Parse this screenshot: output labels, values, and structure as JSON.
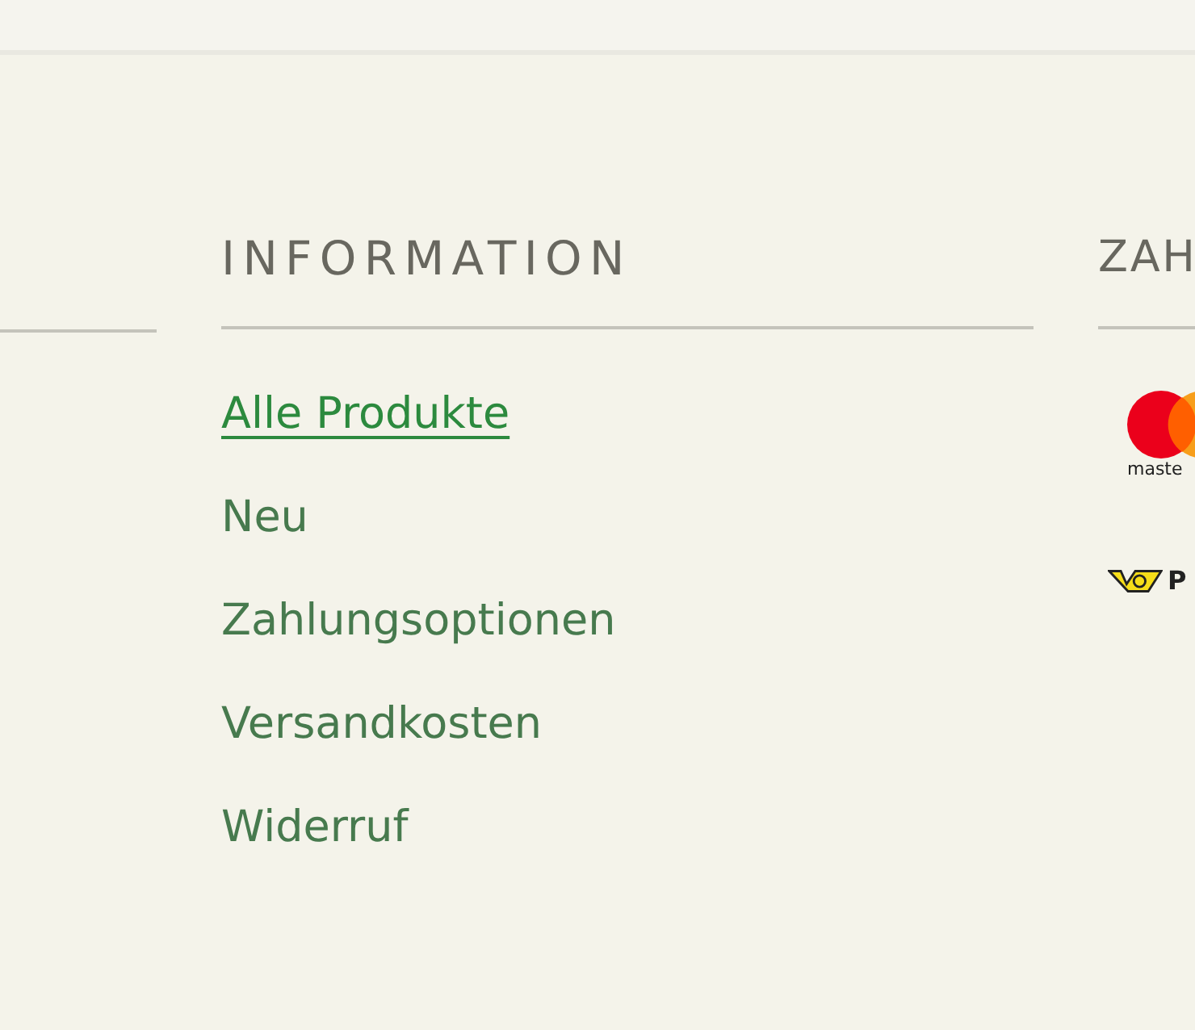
{
  "columns": [
    {
      "heading": "INFORMATION",
      "links": [
        {
          "label": "Alle Produkte",
          "selected": true
        },
        {
          "label": "Neu",
          "selected": false
        },
        {
          "label": "Zahlungsoptionen",
          "selected": false
        },
        {
          "label": "Versandkosten",
          "selected": false
        },
        {
          "label": "Widerruf",
          "selected": false
        }
      ]
    },
    {
      "heading": "ZAH",
      "logos": [
        {
          "kind": "mastercard",
          "caption": "maste"
        },
        {
          "kind": "post",
          "caption": "P"
        }
      ]
    }
  ]
}
